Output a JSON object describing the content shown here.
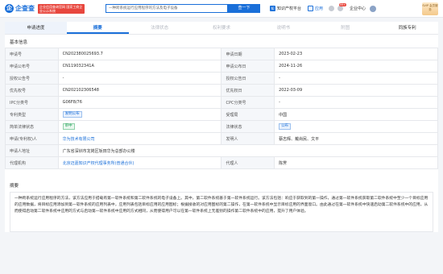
{
  "header": {
    "logo_char": "企",
    "logo_text": "企查查",
    "slogan": "企业信用查询官网 国家工商企业公示系统",
    "search_value": "一种跨系统运行应用程序的方法及电子设备",
    "search_button": "查一下",
    "ip_button": "知识产权平台",
    "app_button": "应用",
    "badge_count": "99+",
    "enterprise_button": "企业中心",
    "svip_label": "SVIP\n会员服务"
  },
  "tabs": [
    {
      "label": "申请进度",
      "state": "first"
    },
    {
      "label": "摘要",
      "state": "active"
    },
    {
      "label": "法律状态",
      "state": "disabled"
    },
    {
      "label": "权利要求",
      "state": "disabled"
    },
    {
      "label": "说明书",
      "state": "disabled"
    },
    {
      "label": "附图",
      "state": "disabled"
    },
    {
      "label": "同族专利",
      "state": "normal"
    }
  ],
  "basic_info": {
    "title": "基本信息",
    "rows": [
      {
        "l1": "申请号",
        "v1": "CN202380025693.7",
        "l2": "申请日期",
        "v2": "2023-02-23"
      },
      {
        "l1": "申请公布号",
        "v1": "CN119032341A",
        "l2": "申请公布日",
        "v2": "2024-11-26"
      },
      {
        "l1": "授权公告号",
        "v1": "-",
        "l2": "授权公告日",
        "v2": "-"
      },
      {
        "l1": "优先权号",
        "v1": "CN202102306548",
        "l2": "优先权日",
        "v2": "2022-03-09"
      },
      {
        "l1": "IPC分类号",
        "v1": "G06F8/76",
        "l2": "CPC分类号",
        "v2": "-"
      },
      {
        "l1": "专利类型",
        "v1": "发明公布",
        "l2": "受理局",
        "v2": "中国"
      },
      {
        "l1": "简单法律状态",
        "v1": "审中",
        "l2": "法律状态",
        "v2": "公布"
      },
      {
        "l1": "申请(专利权)人",
        "v1": "华为技术有限公司",
        "l2": "发明人",
        "v2": "蔡志辉、戴尚民、文平"
      },
      {
        "l1": "申请人地址",
        "v1": "广东省深圳市龙岗区坂田华为总部办公楼",
        "l2": "",
        "v2": ""
      },
      {
        "l1": "代理机构",
        "v1": "北京迈嘉知识产权代理事务所(普通合伙)",
        "l2": "代理人",
        "v2": "陈霁"
      }
    ]
  },
  "abstract": {
    "title": "摘要",
    "text": "一种跨系统运行应用程序的方法，该方法应用于搭载有第一软件系统和第二软件系统的电子设备上。其中，第二软件系统基于第一软件系统运行。该方法包括：响应于获取到的第一操作，通过第一软件系统获取第二软件系统中至少一个目标应用的应用数据，将目标应用添加到第一软件系统的应用列表中，应用列表包括目标应用的应用图标；根据接收的对应用图标的第二操作，在第一软件系统中显示目标应用的界面窗口。由此通过在第一软件系统中快速启动第二软件系统中的应用，从而使得启动第二软件系统中应用的方式与启动第一软件系统中应用的方式相同，从而使得用户可以在第一软件系统上无差别的操作第二软件系统中的应用，提升了用户体验。"
  }
}
